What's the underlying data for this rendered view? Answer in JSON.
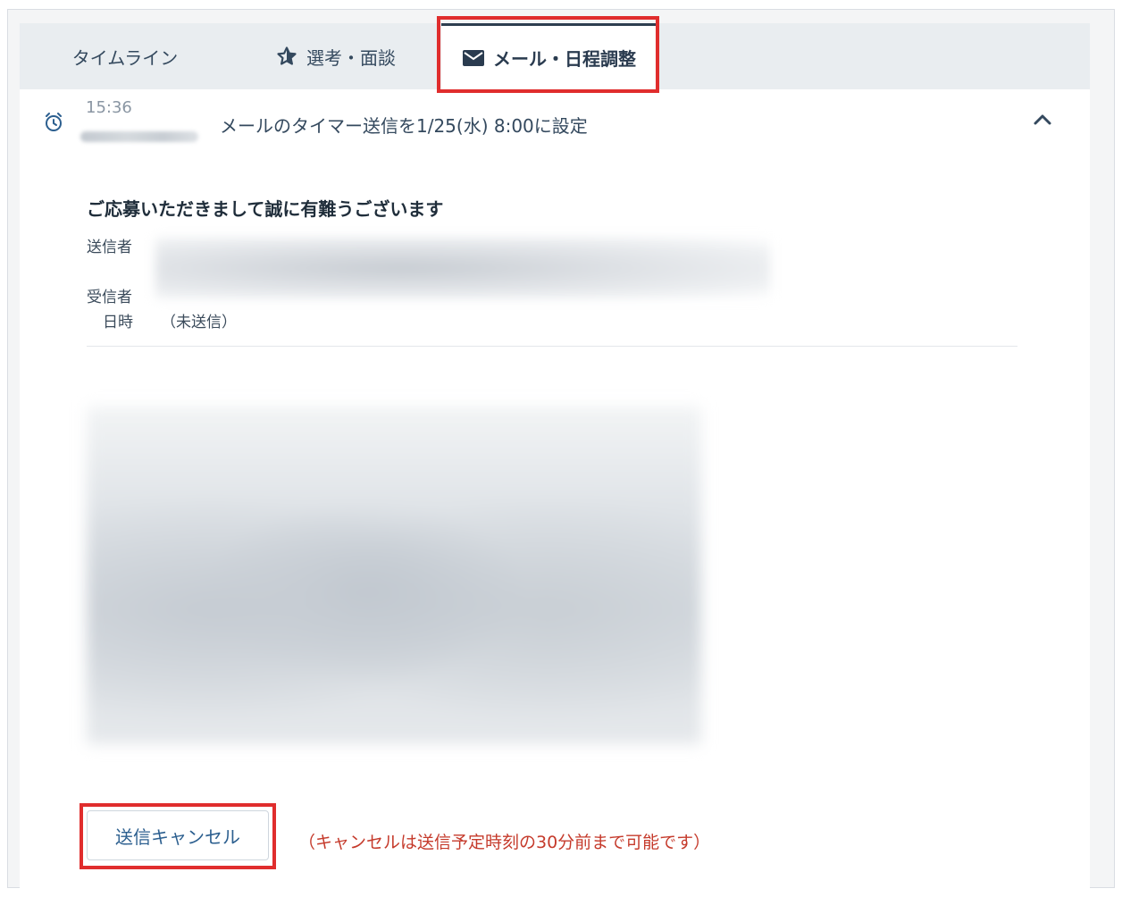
{
  "tabs": {
    "timeline": "タイムライン",
    "selection": "選考・面談",
    "mail": "メール・日程調整"
  },
  "event": {
    "time": "15:36",
    "text": "メールのタイマー送信を1/25(水) 8:00に設定"
  },
  "mail": {
    "subject": "ご応募いただきまして誠に有難うございます",
    "sender_label": "送信者",
    "receiver_label": "受信者",
    "date_label": "日時",
    "date_value": "（未送信）"
  },
  "actions": {
    "cancel_label": "送信キャンセル",
    "cancel_note": "（キャンセルは送信予定時刻の30分前まで可能です）"
  },
  "colors": {
    "highlight": "#e02d2d",
    "note": "#c53a2b",
    "accent": "#2c5f8f"
  },
  "icons": [
    "star-icon",
    "mail-icon",
    "alarm-clock-icon",
    "chevron-up-icon"
  ]
}
